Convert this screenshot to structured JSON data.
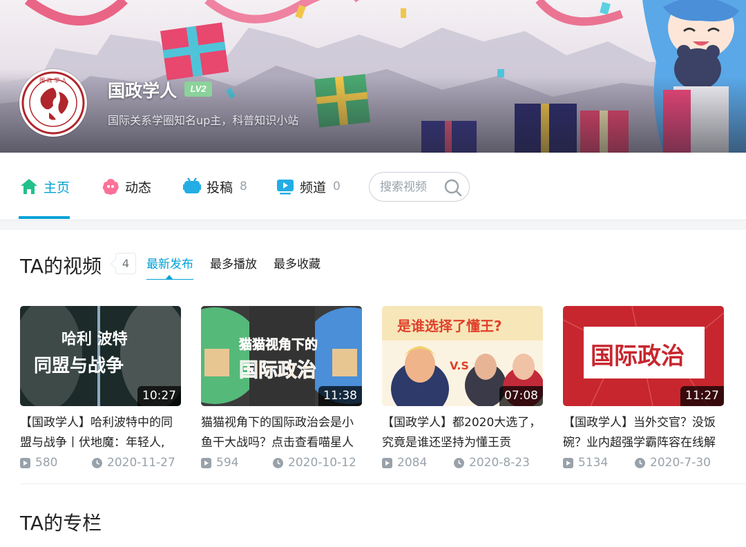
{
  "profile": {
    "name": "国政学人",
    "level": "LV2",
    "sign": "国际关系学圈知名up主，科普知识小站",
    "avatar_logo_text": "国政学人 INTERNATIONAL POLITICS SCHOLARS"
  },
  "nav": {
    "items": [
      {
        "label": "主页",
        "icon": "home-icon",
        "count": "",
        "active": true
      },
      {
        "label": "动态",
        "icon": "activity-icon",
        "count": ""
      },
      {
        "label": "投稿",
        "icon": "uploads-icon",
        "count": "8"
      },
      {
        "label": "频道",
        "icon": "channel-icon",
        "count": "0"
      }
    ],
    "search_placeholder": "搜索视频"
  },
  "videos_section": {
    "title": "TA的视频",
    "count": "4",
    "sort_tabs": [
      "最新发布",
      "最多播放",
      "最多收藏"
    ],
    "active_sort": "最新发布",
    "videos": [
      {
        "title": "【国政学人】哈利波特中的同盟与战争丨伏地魔：年轻人,",
        "duration": "10:27",
        "plays": "580",
        "date": "2020-11-27",
        "thumb_text": [
          "哈利 波特",
          "同盟与战争"
        ]
      },
      {
        "title": "猫猫视角下的国际政治会是小鱼干大战吗？点击查看喵星人",
        "duration": "11:38",
        "plays": "594",
        "date": "2020-10-12",
        "thumb_text": [
          "猫猫视角下的",
          "国际政治"
        ]
      },
      {
        "title": "【国政学人】都2020大选了，究竟是谁还坚持为懂王贡",
        "duration": "07:08",
        "plays": "2084",
        "date": "2020-8-23",
        "thumb_text": [
          "是谁选择了懂王?",
          "V.S"
        ]
      },
      {
        "title": "【国政学人】当外交官？没饭碗？业内超强学霸阵容在线解",
        "duration": "11:27",
        "plays": "5134",
        "date": "2020-7-30",
        "thumb_text": [
          "国际政治"
        ]
      }
    ]
  },
  "column_section": {
    "title": "TA的专栏"
  },
  "colors": {
    "accent": "#00a1d6",
    "muted": "#99a2aa",
    "level_badge": "#8bd29b",
    "nav_home": "#23ade5"
  }
}
